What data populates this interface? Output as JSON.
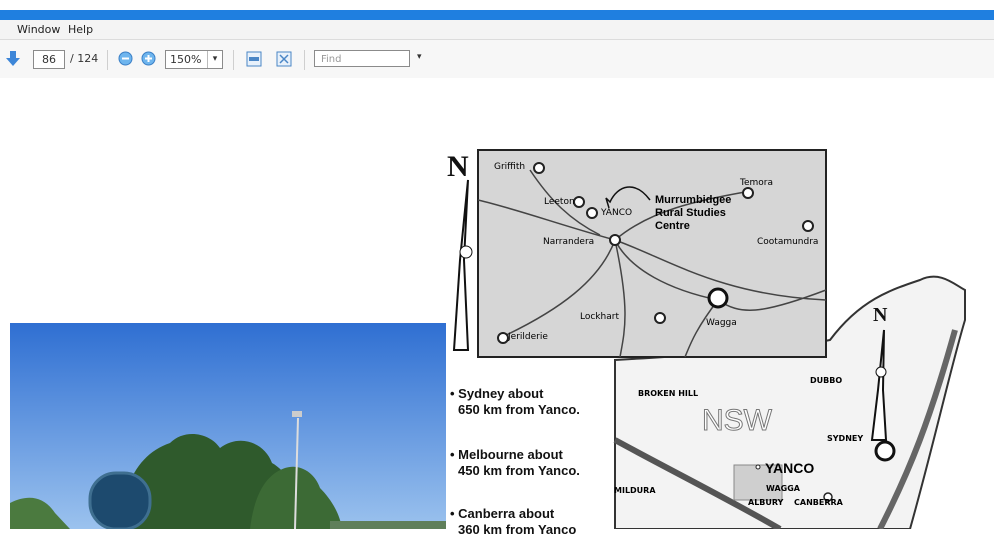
{
  "menu": {
    "window": "Window",
    "help": "Help"
  },
  "toolbar": {
    "page_current": "86",
    "page_total": "/ 124",
    "zoom": "150%",
    "find_placeholder": "Find",
    "dropdown": "▾"
  },
  "map": {
    "north": "N",
    "places": {
      "griffith": "Griffith",
      "leeton": "Leeton",
      "yanco_small": "YANCO",
      "narrandera": "Narrandera",
      "murrumbidgee1": "Murrumbidgee",
      "murrumbidgee2": "Rural Studies",
      "murrumbidgee3": "Centre",
      "temora": "Temora",
      "cootamundra": "Cootamundra",
      "lockhart": "Lockhart",
      "wagga_small": "Wagga",
      "jerilderie": "Jerilderie",
      "broken_hill": "BROKEN HILL",
      "dubbo": "DUBBO",
      "nsw": "NSW",
      "sydney": "SYDNEY",
      "yanco_big": "YANCO",
      "wagga_big": "WAGGA",
      "albury": "ALBURY",
      "canberra": "CANBERRA",
      "mildura": "MILDURA"
    }
  },
  "bullets": [
    {
      "line1": "• Sydney about",
      "line2": "650 km from Yanco."
    },
    {
      "line1": "• Melbourne about",
      "line2": "450 km from Yanco."
    },
    {
      "line1": "• Canberra about",
      "line2": "360 km from Yanco"
    }
  ]
}
